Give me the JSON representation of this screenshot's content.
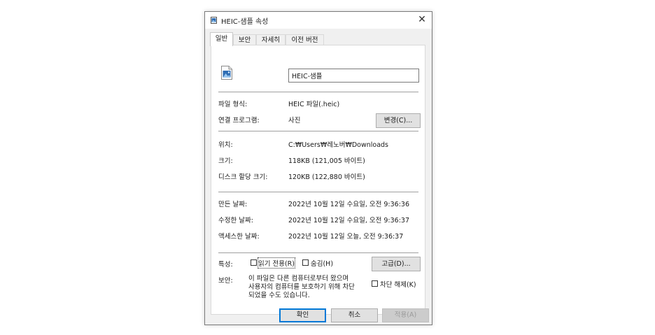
{
  "window": {
    "title": "HEIC-샘플 속성",
    "close_label": "✕"
  },
  "tabs": [
    {
      "label": "일반",
      "active": true
    },
    {
      "label": "보안"
    },
    {
      "label": "자세히"
    },
    {
      "label": "이전 버전"
    }
  ],
  "file_name": "HEIC-샘플",
  "fields": {
    "type": {
      "label": "파일 형식:",
      "value": "HEIC 파일(.heic)"
    },
    "opens_with": {
      "label": "연결 프로그램:",
      "value": "사진",
      "change_button": "변경(C)..."
    },
    "location": {
      "label": "위치:",
      "value": "C:₩Users₩레노버₩Downloads"
    },
    "size": {
      "label": "크기:",
      "value": "118KB (121,005 바이트)"
    },
    "disk_size": {
      "label": "디스크 할당 크기:",
      "value": "120KB (122,880 바이트)"
    },
    "created": {
      "label": "만든 날짜:",
      "value": "2022년 10월 12일 수요일, 오전 9:36:36"
    },
    "modified": {
      "label": "수정한 날짜:",
      "value": "2022년 10월 12일 수요일, 오전 9:36:37"
    },
    "accessed": {
      "label": "액세스한 날짜:",
      "value": "2022년 10월 12일 오늘, 오전 9:36:37"
    }
  },
  "attributes": {
    "label": "특성:",
    "readonly": "읽기 전용(R)",
    "hidden": "숨김(H)",
    "advanced_button": "고급(D)..."
  },
  "security": {
    "label": "보안:",
    "lines": [
      "이 파일은 다른 컴퓨터로부터 왔으며",
      "사용자의 컴퓨터를 보호하기 위해 차단",
      "되었을 수도 있습니다."
    ],
    "unblock": "차단 해제(K)"
  },
  "buttons": {
    "ok": "확인",
    "cancel": "취소",
    "apply": "적용(A)"
  },
  "colors": {
    "accent": "#0078d7",
    "image_icon_blue": "#2f6db3"
  }
}
